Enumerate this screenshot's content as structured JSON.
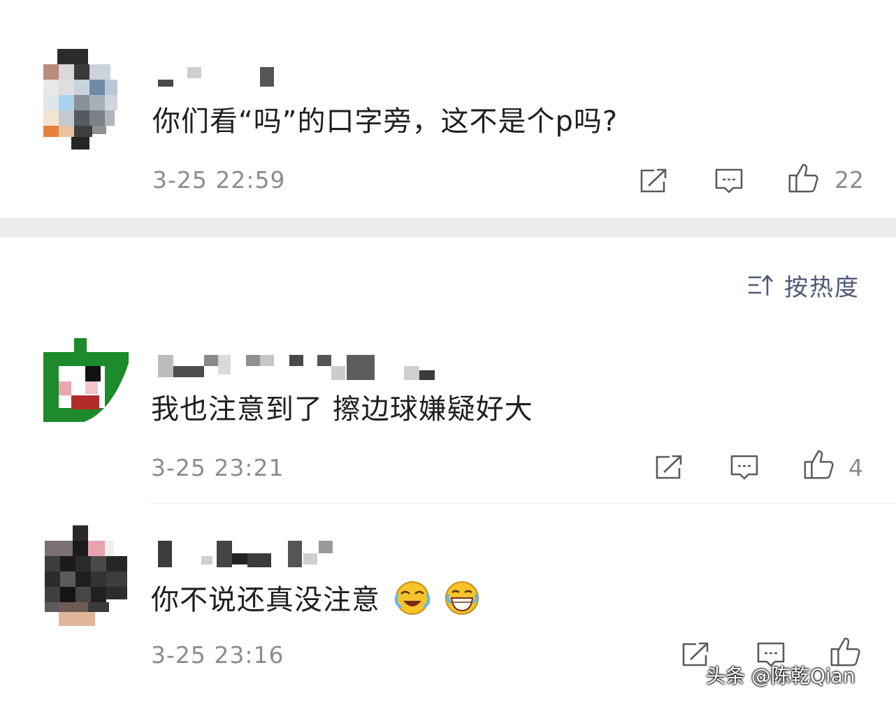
{
  "comments": [
    {
      "text": "你们看“吗”的口字旁，这不是个p吗?",
      "time": "3-25 22:59",
      "likes": "22"
    },
    {
      "text": "我也注意到了 擦边球嫌疑好大",
      "time": "3-25 23:21",
      "likes": "4"
    },
    {
      "text": "你不说还真没注意",
      "time": "3-25 23:16",
      "emoji": [
        "crying-laughing-emoji",
        "grinning-tears-emoji"
      ]
    }
  ],
  "sort": {
    "label": "按热度",
    "icon": "sort-icon"
  },
  "watermark": "头条 @陈乾Qian",
  "colors": {
    "text": "#1f1f1f",
    "meta": "#8b8b93",
    "sort": "#4e5878",
    "band": "#ececef",
    "avatar2": "#1d8a2c"
  }
}
